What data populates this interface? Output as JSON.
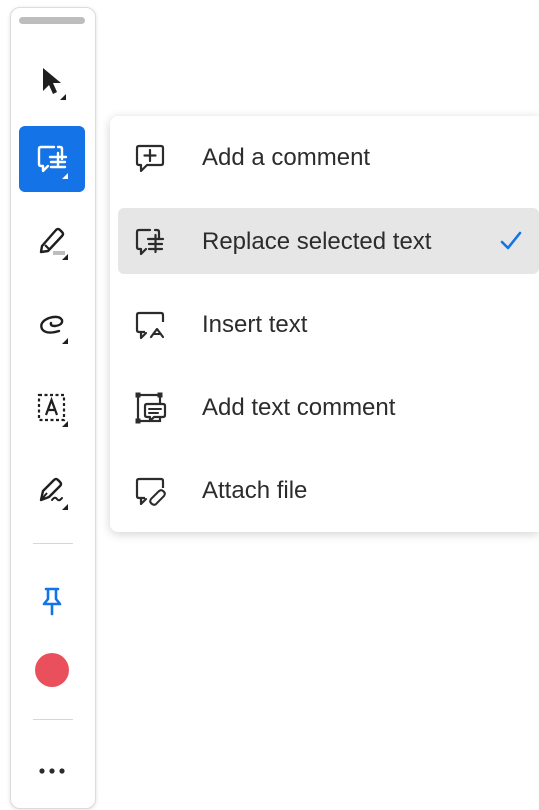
{
  "colors": {
    "accent": "#1473e6",
    "record": "#e9505b"
  },
  "toolbar": {
    "tools": [
      {
        "name": "select-tool",
        "icon": "pointer-arrow-icon"
      },
      {
        "name": "comment-tool",
        "icon": "replace-text-icon",
        "active": true
      },
      {
        "name": "highlight-tool",
        "icon": "highlighter-icon"
      },
      {
        "name": "draw-tool",
        "icon": "freehand-loop-icon"
      },
      {
        "name": "text-box-tool",
        "icon": "text-box-icon"
      },
      {
        "name": "sign-tool",
        "icon": "pen-sign-icon"
      },
      {
        "name": "pin-tool",
        "icon": "pin-icon"
      },
      {
        "name": "record-tool",
        "icon": "red-circle-icon"
      },
      {
        "name": "more-tool",
        "icon": "more-icon"
      }
    ],
    "more_label": "•••"
  },
  "menu": {
    "items": [
      {
        "label": "Add a comment",
        "icon": "add-comment-icon"
      },
      {
        "label": "Replace selected text",
        "icon": "replace-text-icon",
        "selected": true
      },
      {
        "label": "Insert text",
        "icon": "insert-text-icon"
      },
      {
        "label": "Add text comment",
        "icon": "text-comment-icon"
      },
      {
        "label": "Attach file",
        "icon": "attach-file-icon"
      }
    ],
    "check_icon": "checkmark-icon"
  }
}
